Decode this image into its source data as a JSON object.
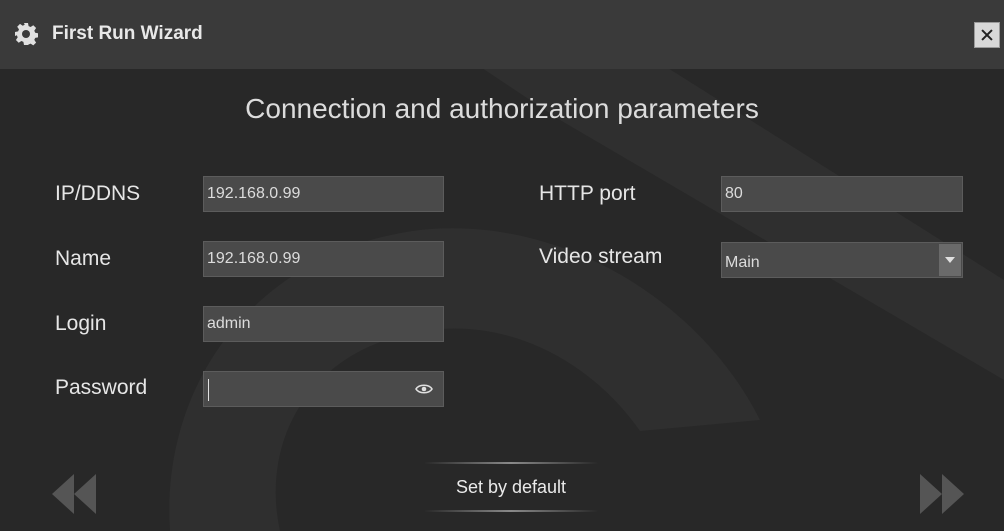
{
  "window": {
    "title": "First Run Wizard",
    "title_icon": "gear-icon",
    "close_icon": "close-icon"
  },
  "heading": "Connection and authorization parameters",
  "fields": {
    "ip": {
      "label": "IP/DDNS",
      "value": "192.168.0.99"
    },
    "name": {
      "label": "Name",
      "value": "192.168.0.99"
    },
    "login": {
      "label": "Login",
      "value": "admin"
    },
    "password": {
      "label": "Password",
      "value": "",
      "icon": "eye-icon"
    },
    "http_port": {
      "label": "HTTP port",
      "value": "80"
    },
    "video_stream": {
      "label": "Video stream",
      "value": "Main",
      "icon": "chevron-down-icon"
    }
  },
  "footer": {
    "set_default_label": "Set by default",
    "prev_icon": "double-chevron-left-icon",
    "next_icon": "double-chevron-right-icon"
  },
  "colors": {
    "background": "#282828",
    "titlebar": "#3a3a3a",
    "field_bg": "#4a4a4a",
    "text": "#e6e6e6"
  }
}
